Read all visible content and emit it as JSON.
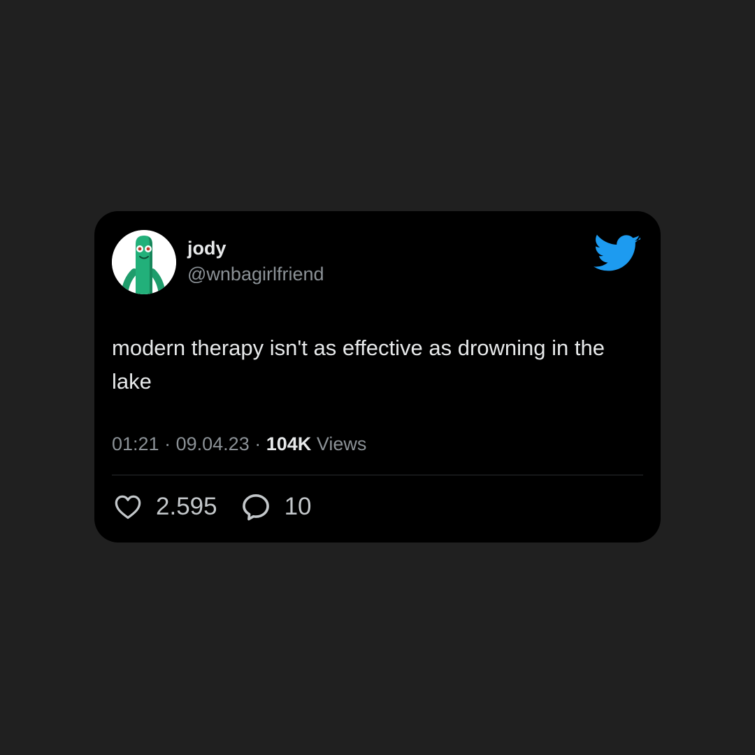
{
  "user": {
    "display_name": "jody",
    "handle": "@wnbagirlfriend",
    "avatar_icon": "gumby-avatar"
  },
  "tweet": {
    "text": "modern therapy isn't as effective as drowning in the lake",
    "time": "01:21",
    "date": "09.04.23",
    "views_count": "104K",
    "views_label": "Views",
    "separator": "·"
  },
  "actions": {
    "likes": "2.595",
    "replies": "10"
  },
  "icons": {
    "brand": "twitter-bird-icon",
    "like": "heart-icon",
    "reply": "reply-bubble-icon"
  },
  "colors": {
    "background": "#202020",
    "card": "#000000",
    "brand": "#1d9bf0",
    "text_primary": "#e7e9ea",
    "text_secondary": "#8b9196"
  }
}
